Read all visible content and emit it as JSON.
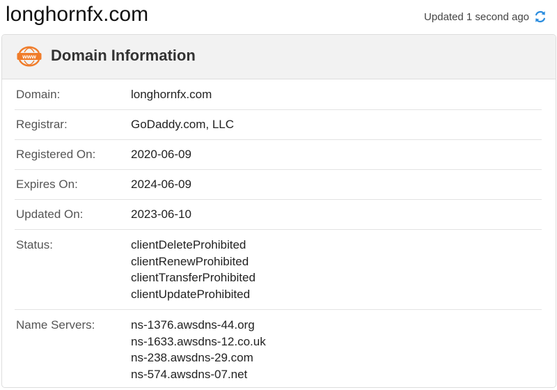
{
  "header": {
    "site_title": "longhornfx.com",
    "updated_text": "Updated 1 second ago",
    "refresh_icon": "refresh-icon",
    "accent_color": "#2a8cde"
  },
  "card": {
    "title": "Domain Information",
    "icon": "www-icon",
    "icon_color": "#f07c2a"
  },
  "rows": {
    "domain": {
      "label": "Domain:",
      "value": "longhornfx.com"
    },
    "registrar": {
      "label": "Registrar:",
      "value": "GoDaddy.com, LLC"
    },
    "registered_on": {
      "label": "Registered On:",
      "value": "2020-06-09"
    },
    "expires_on": {
      "label": "Expires On:",
      "value": "2024-06-09"
    },
    "updated_on": {
      "label": "Updated On:",
      "value": "2023-06-10"
    },
    "status": {
      "label": "Status:",
      "values": [
        "clientDeleteProhibited",
        "clientRenewProhibited",
        "clientTransferProhibited",
        "clientUpdateProhibited"
      ]
    },
    "name_servers": {
      "label": "Name Servers:",
      "values": [
        "ns-1376.awsdns-44.org",
        "ns-1633.awsdns-12.co.uk",
        "ns-238.awsdns-29.com",
        "ns-574.awsdns-07.net"
      ]
    }
  }
}
